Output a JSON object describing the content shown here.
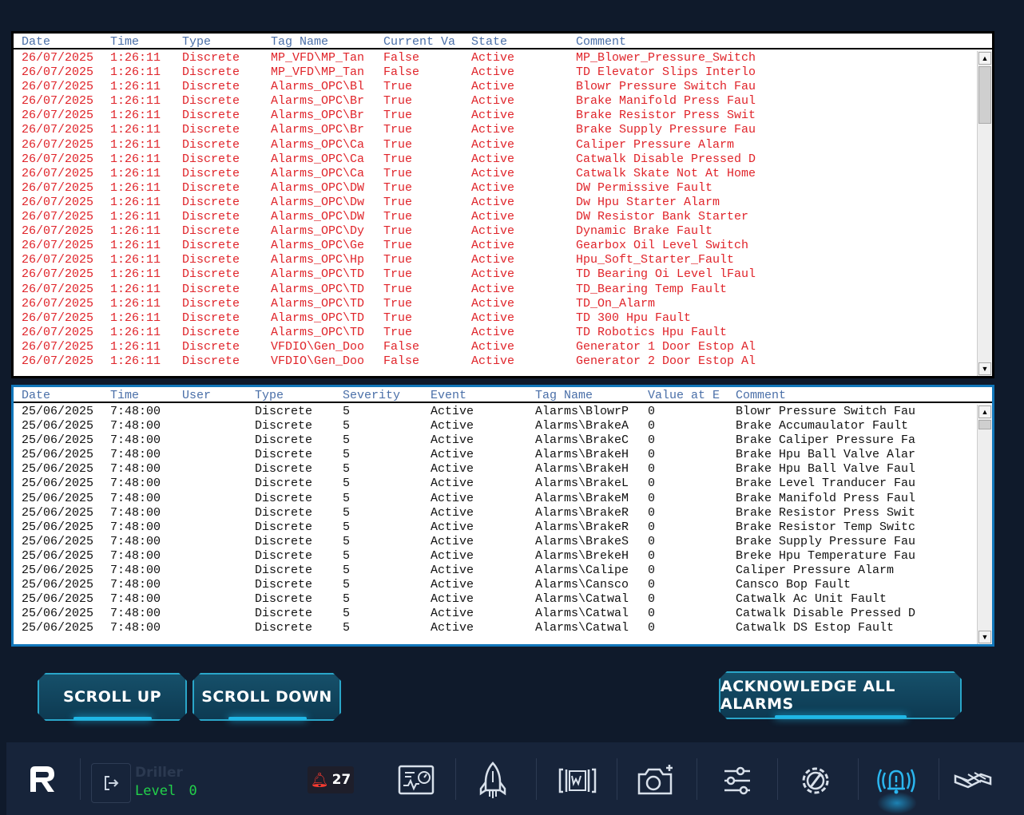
{
  "active_alarms": {
    "columns": [
      "Date",
      "Time",
      "Type",
      "Tag Name",
      "Current Va",
      "State",
      "Comment"
    ],
    "rows": [
      [
        "26/07/2025",
        "1:26:11",
        "Discrete",
        "MP_VFD\\MP_Tan",
        "False",
        "Active",
        "MP_Blower_Pressure_Switch"
      ],
      [
        "26/07/2025",
        "1:26:11",
        "Discrete",
        "MP_VFD\\MP_Tan",
        "False",
        "Active",
        "TD Elevator Slips Interlo"
      ],
      [
        "26/07/2025",
        "1:26:11",
        "Discrete",
        "Alarms_OPC\\Bl",
        "True",
        "Active",
        "Blowr Pressure Switch Fau"
      ],
      [
        "26/07/2025",
        "1:26:11",
        "Discrete",
        "Alarms_OPC\\Br",
        "True",
        "Active",
        "Brake Manifold Press Faul"
      ],
      [
        "26/07/2025",
        "1:26:11",
        "Discrete",
        "Alarms_OPC\\Br",
        "True",
        "Active",
        "Brake Resistor Press Swit"
      ],
      [
        "26/07/2025",
        "1:26:11",
        "Discrete",
        "Alarms_OPC\\Br",
        "True",
        "Active",
        "Brake Supply Pressure Fau"
      ],
      [
        "26/07/2025",
        "1:26:11",
        "Discrete",
        "Alarms_OPC\\Ca",
        "True",
        "Active",
        "Caliper Pressure Alarm"
      ],
      [
        "26/07/2025",
        "1:26:11",
        "Discrete",
        "Alarms_OPC\\Ca",
        "True",
        "Active",
        "Catwalk Disable Pressed D"
      ],
      [
        "26/07/2025",
        "1:26:11",
        "Discrete",
        "Alarms_OPC\\Ca",
        "True",
        "Active",
        "Catwalk Skate Not At Home"
      ],
      [
        "26/07/2025",
        "1:26:11",
        "Discrete",
        "Alarms_OPC\\DW",
        "True",
        "Active",
        "DW Permissive Fault"
      ],
      [
        "26/07/2025",
        "1:26:11",
        "Discrete",
        "Alarms_OPC\\Dw",
        "True",
        "Active",
        "Dw Hpu Starter Alarm"
      ],
      [
        "26/07/2025",
        "1:26:11",
        "Discrete",
        "Alarms_OPC\\DW",
        "True",
        "Active",
        "DW Resistor Bank Starter"
      ],
      [
        "26/07/2025",
        "1:26:11",
        "Discrete",
        "Alarms_OPC\\Dy",
        "True",
        "Active",
        "Dynamic Brake Fault"
      ],
      [
        "26/07/2025",
        "1:26:11",
        "Discrete",
        "Alarms_OPC\\Ge",
        "True",
        "Active",
        "Gearbox Oil Level Switch"
      ],
      [
        "26/07/2025",
        "1:26:11",
        "Discrete",
        "Alarms_OPC\\Hp",
        "True",
        "Active",
        "Hpu_Soft_Starter_Fault"
      ],
      [
        "26/07/2025",
        "1:26:11",
        "Discrete",
        "Alarms_OPC\\TD",
        "True",
        "Active",
        "TD Bearing Oi Level lFaul"
      ],
      [
        "26/07/2025",
        "1:26:11",
        "Discrete",
        "Alarms_OPC\\TD",
        "True",
        "Active",
        "TD_Bearing Temp Fault"
      ],
      [
        "26/07/2025",
        "1:26:11",
        "Discrete",
        "Alarms_OPC\\TD",
        "True",
        "Active",
        "TD_On_Alarm"
      ],
      [
        "26/07/2025",
        "1:26:11",
        "Discrete",
        "Alarms_OPC\\TD",
        "True",
        "Active",
        "TD 300 Hpu Fault"
      ],
      [
        "26/07/2025",
        "1:26:11",
        "Discrete",
        "Alarms_OPC\\TD",
        "True",
        "Active",
        "TD Robotics Hpu Fault"
      ],
      [
        "26/07/2025",
        "1:26:11",
        "Discrete",
        "VFDIO\\Gen_Doo",
        "False",
        "Active",
        "Generator 1 Door Estop Al"
      ],
      [
        "26/07/2025",
        "1:26:11",
        "Discrete",
        "VFDIO\\Gen_Doo",
        "False",
        "Active",
        "Generator 2 Door Estop Al"
      ]
    ]
  },
  "alarm_history": {
    "columns": [
      "Date",
      "Time",
      "User",
      "Type",
      "Severity",
      "Event",
      "Tag Name",
      "Value at E",
      "Comment"
    ],
    "rows": [
      [
        "25/06/2025",
        "7:48:00",
        "",
        "Discrete",
        "5",
        "Active",
        "Alarms\\BlowrP",
        "0",
        "Blowr Pressure Switch Fau"
      ],
      [
        "25/06/2025",
        "7:48:00",
        "",
        "Discrete",
        "5",
        "Active",
        "Alarms\\BrakeA",
        "0",
        "Brake Accumaulator Fault"
      ],
      [
        "25/06/2025",
        "7:48:00",
        "",
        "Discrete",
        "5",
        "Active",
        "Alarms\\BrakeC",
        "0",
        "Brake Caliper Pressure Fa"
      ],
      [
        "25/06/2025",
        "7:48:00",
        "",
        "Discrete",
        "5",
        "Active",
        "Alarms\\BrakeH",
        "0",
        "Brake Hpu Ball Valve Alar"
      ],
      [
        "25/06/2025",
        "7:48:00",
        "",
        "Discrete",
        "5",
        "Active",
        "Alarms\\BrakeH",
        "0",
        "Brake Hpu Ball Valve Faul"
      ],
      [
        "25/06/2025",
        "7:48:00",
        "",
        "Discrete",
        "5",
        "Active",
        "Alarms\\BrakeL",
        "0",
        "Brake Level Tranducer Fau"
      ],
      [
        "25/06/2025",
        "7:48:00",
        "",
        "Discrete",
        "5",
        "Active",
        "Alarms\\BrakeM",
        "0",
        "Brake Manifold Press Faul"
      ],
      [
        "25/06/2025",
        "7:48:00",
        "",
        "Discrete",
        "5",
        "Active",
        "Alarms\\BrakeR",
        "0",
        "Brake Resistor Press Swit"
      ],
      [
        "25/06/2025",
        "7:48:00",
        "",
        "Discrete",
        "5",
        "Active",
        "Alarms\\BrakeR",
        "0",
        "Brake Resistor Temp Switc"
      ],
      [
        "25/06/2025",
        "7:48:00",
        "",
        "Discrete",
        "5",
        "Active",
        "Alarms\\BrakeS",
        "0",
        "Brake Supply Pressure Fau"
      ],
      [
        "25/06/2025",
        "7:48:00",
        "",
        "Discrete",
        "5",
        "Active",
        "Alarms\\BrekeH",
        "0",
        "Breke Hpu Temperature Fau"
      ],
      [
        "25/06/2025",
        "7:48:00",
        "",
        "Discrete",
        "5",
        "Active",
        "Alarms\\Calipe",
        "0",
        "Caliper Pressure Alarm"
      ],
      [
        "25/06/2025",
        "7:48:00",
        "",
        "Discrete",
        "5",
        "Active",
        "Alarms\\Cansco",
        "0",
        "Cansco Bop Fault"
      ],
      [
        "25/06/2025",
        "7:48:00",
        "",
        "Discrete",
        "5",
        "Active",
        "Alarms\\Catwal",
        "0",
        "Catwalk Ac Unit Fault"
      ],
      [
        "25/06/2025",
        "7:48:00",
        "",
        "Discrete",
        "5",
        "Active",
        "Alarms\\Catwal",
        "0",
        "Catwalk Disable Pressed D"
      ],
      [
        "25/06/2025",
        "7:48:00",
        "",
        "Discrete",
        "5",
        "Active",
        "Alarms\\Catwal",
        "0",
        "Catwalk DS Estop Fault"
      ]
    ]
  },
  "buttons": {
    "scroll_up": "SCROLL UP",
    "scroll_down": "SCROLL DOWN",
    "ack_all": "ACKNOWLEDGE ALL ALARMS"
  },
  "taskbar": {
    "user_role": "Driller",
    "level_label": "Level",
    "level_value": "0",
    "alarm_count": "27",
    "icons": [
      "r-logo-icon",
      "logout-icon",
      "bell-icon",
      "gauge-monitor-icon",
      "rocket-icon",
      "weight-window-icon",
      "camera-icon",
      "sliders-icon",
      "settings-wrench-icon",
      "alarm-bell-icon",
      "pipe-handling-icon"
    ]
  },
  "colors": {
    "background": "#0f1a2b",
    "active_alarm_text": "#e0242a",
    "header_text": "#4a6fa8",
    "accent": "#2aa6c9",
    "level_green": "#22d14a",
    "taskbar_bg": "#17243a"
  }
}
